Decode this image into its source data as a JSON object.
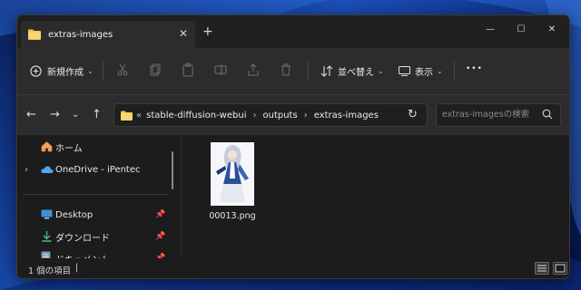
{
  "window": {
    "tab_title": "extras-images",
    "tab_close": "✕",
    "new_tab": "+",
    "controls": {
      "minimize": "—",
      "maximize": "☐",
      "close": "✕"
    }
  },
  "toolbar": {
    "new_label": "新規作成",
    "sort_label": "並べ替え",
    "view_label": "表示",
    "more_label": "•••"
  },
  "address": {
    "overflow": "«",
    "crumbs": [
      "stable-diffusion-webui",
      "outputs",
      "extras-images"
    ],
    "separator": "›",
    "search_placeholder": "extras-imagesの検索"
  },
  "nav": {
    "items": [
      {
        "label": "ホーム",
        "icon": "home-icon",
        "pinned": false
      },
      {
        "label": "OneDrive - iPentec",
        "icon": "onedrive-cloud-icon",
        "pinned": false
      },
      {
        "label": "Desktop",
        "icon": "desktop-icon",
        "pinned": true
      },
      {
        "label": "ダウンロード",
        "icon": "download-icon",
        "pinned": true
      },
      {
        "label": "ドキュメント",
        "icon": "document-icon",
        "pinned": true
      }
    ],
    "expand_glyph": "›",
    "pin_glyph": "📌"
  },
  "files": [
    {
      "name": "00013.png",
      "type": "image"
    }
  ],
  "status": {
    "count": "1 個の項目",
    "caret": "|"
  },
  "colors": {
    "window_bg": "#1c1c1c",
    "toolbar_bg": "#2c2c2c",
    "folder_yellow": "#f2c94c",
    "accent_blue": "#4fa8f0"
  }
}
